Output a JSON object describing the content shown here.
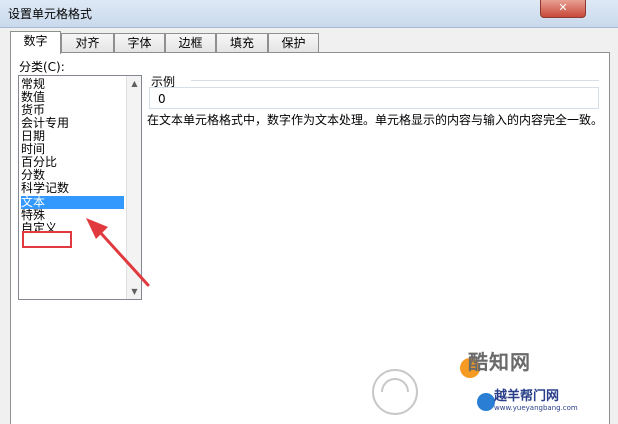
{
  "window": {
    "title": "设置单元格格式",
    "close_label": "✕"
  },
  "tabs": [
    {
      "label": "数字",
      "active": true
    },
    {
      "label": "对齐"
    },
    {
      "label": "字体"
    },
    {
      "label": "边框"
    },
    {
      "label": "填充"
    },
    {
      "label": "保护"
    }
  ],
  "category": {
    "label": "分类(C):",
    "items": [
      "常规",
      "数值",
      "货币",
      "会计专用",
      "日期",
      "时间",
      "百分比",
      "分数",
      "科学记数",
      "文本",
      "特殊",
      "自定义"
    ],
    "selected": "文本"
  },
  "sample": {
    "legend": "示例",
    "value": "0"
  },
  "description": "在文本单元格格式中，数字作为文本处理。单元格显示的内容与输入的内容完全一致。",
  "watermark": {
    "brand": "酷知网",
    "site_name": "越羊帮门网",
    "site_url": "www.yueyangbang.com"
  },
  "colors": {
    "selection": "#3399ff",
    "annotation": "#e0393e"
  }
}
